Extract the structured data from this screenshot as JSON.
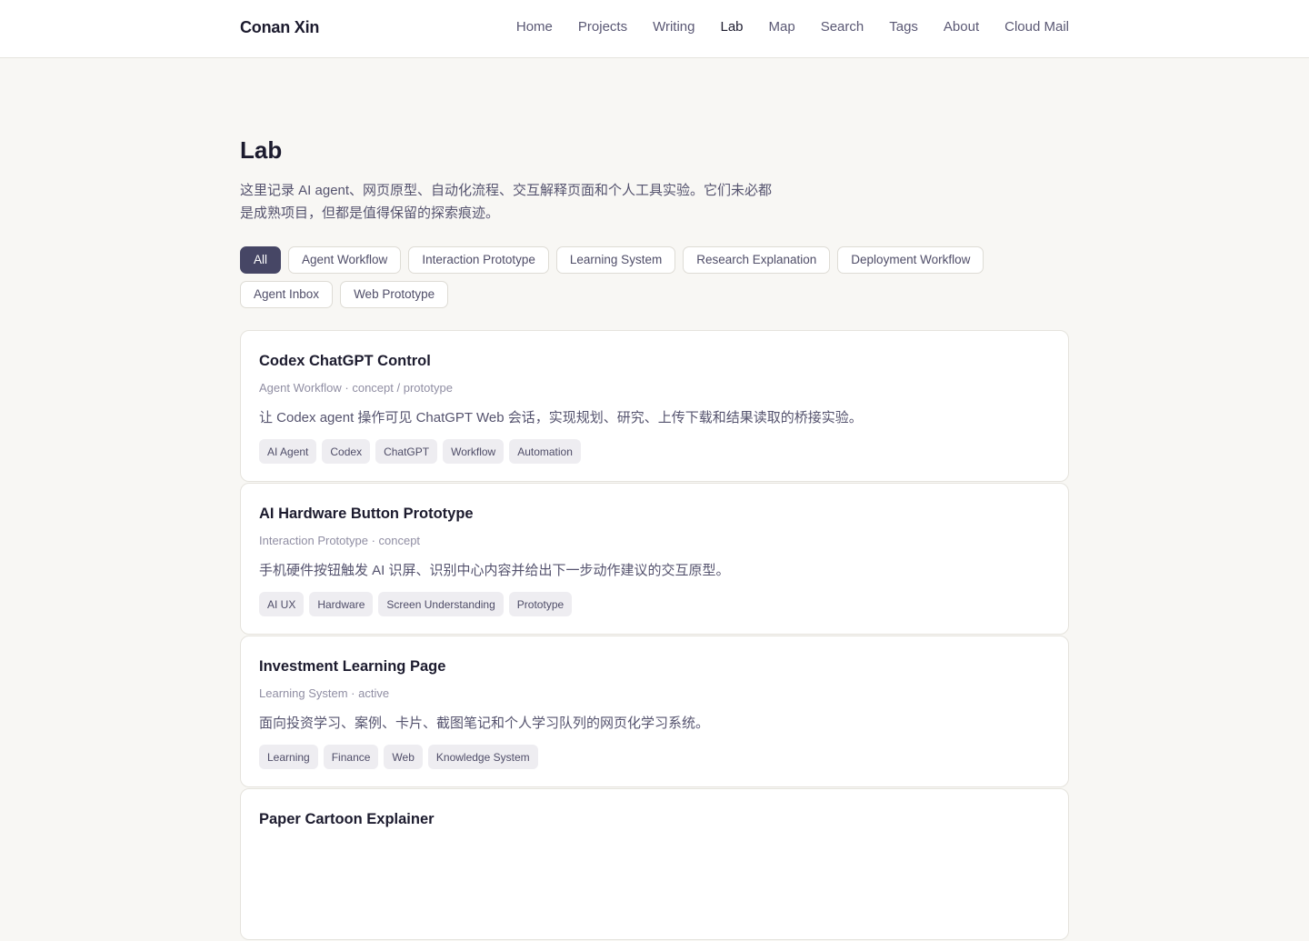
{
  "header": {
    "brand": "Conan Xin",
    "nav": [
      {
        "label": "Home",
        "active": false
      },
      {
        "label": "Projects",
        "active": false
      },
      {
        "label": "Writing",
        "active": false
      },
      {
        "label": "Lab",
        "active": true
      },
      {
        "label": "Map",
        "active": false
      },
      {
        "label": "Search",
        "active": false
      },
      {
        "label": "Tags",
        "active": false
      },
      {
        "label": "About",
        "active": false
      },
      {
        "label": "Cloud Mail",
        "active": false
      }
    ]
  },
  "main": {
    "title": "Lab",
    "intro": "这里记录 AI agent、网页原型、自动化流程、交互解释页面和个人工具实验。它们未必都是成熟项目，但都是值得保留的探索痕迹。",
    "filters": [
      {
        "label": "All",
        "active": true
      },
      {
        "label": "Agent Workflow",
        "active": false
      },
      {
        "label": "Interaction Prototype",
        "active": false
      },
      {
        "label": "Learning System",
        "active": false
      },
      {
        "label": "Research Explanation",
        "active": false
      },
      {
        "label": "Deployment Workflow",
        "active": false
      },
      {
        "label": "Agent Inbox",
        "active": false
      },
      {
        "label": "Web Prototype",
        "active": false
      }
    ],
    "items": [
      {
        "title": "Codex ChatGPT Control",
        "meta": "Agent Workflow · concept / prototype",
        "description": "让 Codex agent 操作可见 ChatGPT Web 会话，实现规划、研究、上传下载和结果读取的桥接实验。",
        "tags": [
          "AI Agent",
          "Codex",
          "ChatGPT",
          "Workflow",
          "Automation"
        ]
      },
      {
        "title": "AI Hardware Button Prototype",
        "meta": "Interaction Prototype · concept",
        "description": "手机硬件按钮触发 AI 识屏、识别中心内容并给出下一步动作建议的交互原型。",
        "tags": [
          "AI UX",
          "Hardware",
          "Screen Understanding",
          "Prototype"
        ]
      },
      {
        "title": "Investment Learning Page",
        "meta": "Learning System · active",
        "description": "面向投资学习、案例、卡片、截图笔记和个人学习队列的网页化学习系统。",
        "tags": [
          "Learning",
          "Finance",
          "Web",
          "Knowledge System"
        ]
      },
      {
        "title": "Paper Cartoon Explainer",
        "meta": "",
        "description": "",
        "tags": []
      }
    ]
  }
}
